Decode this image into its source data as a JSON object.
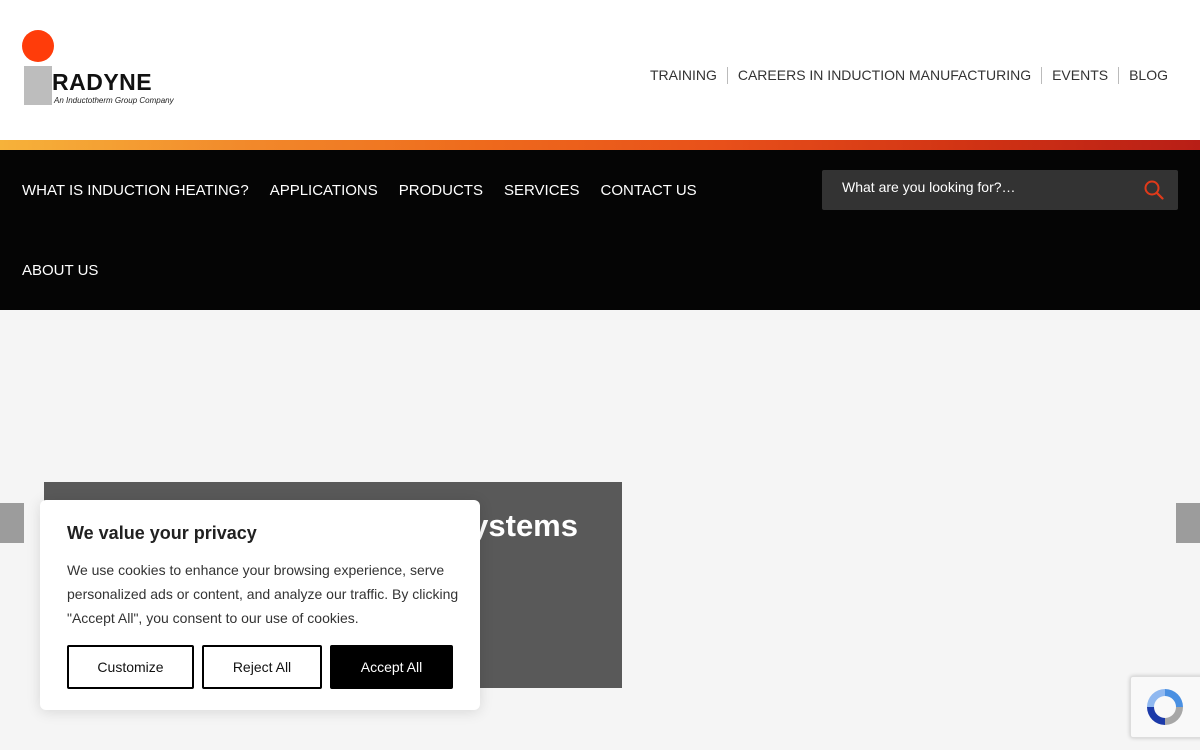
{
  "brand": {
    "name": "RADYNE",
    "tagline": "An Inductotherm Group Company",
    "colors": {
      "dot": "#ff3c0a",
      "accent": "#e03a1a"
    }
  },
  "utility_nav": [
    {
      "label": "TRAINING"
    },
    {
      "label": "CAREERS IN INDUCTION MANUFACTURING"
    },
    {
      "label": "EVENTS"
    },
    {
      "label": "BLOG"
    }
  ],
  "main_nav": [
    {
      "label": "WHAT IS INDUCTION HEATING?"
    },
    {
      "label": "APPLICATIONS"
    },
    {
      "label": "PRODUCTS"
    },
    {
      "label": "SERVICES"
    },
    {
      "label": "CONTACT US"
    },
    {
      "label": "ABOUT US"
    }
  ],
  "search": {
    "placeholder": "What are you looking for?…",
    "icon": "search-icon"
  },
  "hero": {
    "title_visible": "ystems"
  },
  "cookie": {
    "title": "We value your privacy",
    "body": "We use cookies to enhance your browsing experience, serve personalized ads or content, and analyze our traffic. By clicking \"Accept All\", you consent to our use of cookies.",
    "customize_label": "Customize",
    "reject_label": "Reject All",
    "accept_label": "Accept All"
  },
  "recaptcha": {
    "icon": "recaptcha-icon"
  }
}
